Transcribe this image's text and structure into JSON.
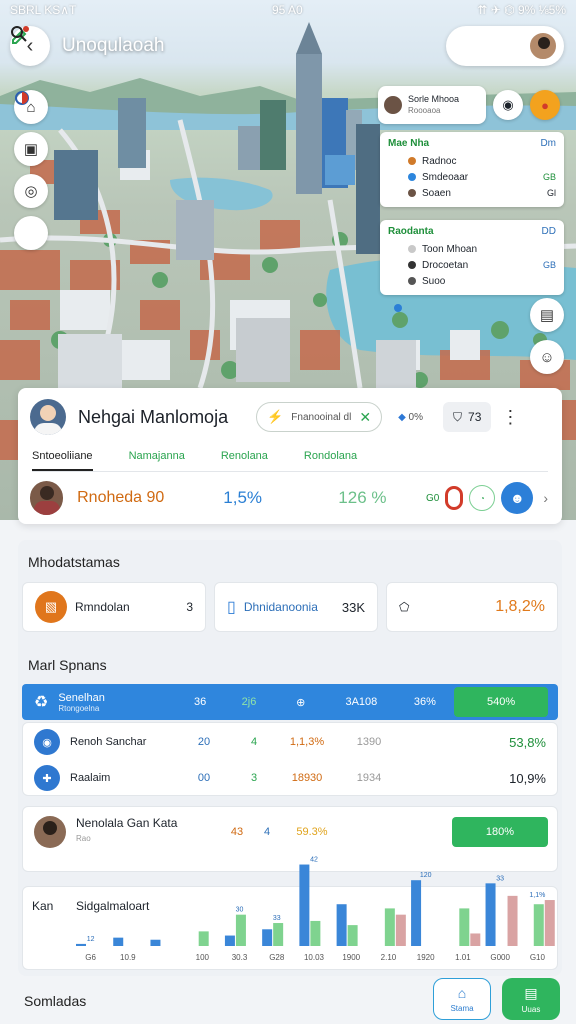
{
  "status": {
    "left": "SBRL  KS∧T",
    "time": "95 A0",
    "right": "⇈ ✈ ⌬ 9% ⅛5%"
  },
  "header": {
    "title": "Unoqulaoah",
    "back_icon": "chevron-left-icon",
    "action_icons": [
      "edit-icon",
      "search-icon"
    ]
  },
  "map_tools": [
    "home-icon",
    "bag-icon",
    "layers-icon",
    "compass-icon"
  ],
  "user_chip": {
    "name": "Sorle Mhooa",
    "sub": "Roooaoa"
  },
  "legend_card_1": {
    "title": "Mae Nha",
    "tag": "Dm",
    "rows": [
      {
        "label": "Radnoc",
        "value": "",
        "color": "#d07a2a"
      },
      {
        "label": "Smdeoaar",
        "value": "GB",
        "color": "#2d86dd"
      },
      {
        "label": "Soaen",
        "value": "Gl",
        "color": "#6b5345"
      }
    ]
  },
  "legend_card_2": {
    "title": "Raodanta",
    "tag": "DD",
    "rows": [
      {
        "label": "Toon Mhoan",
        "value": "",
        "color": "#c9c9c9"
      },
      {
        "label": "Drocoetan",
        "value": "GB",
        "color": "#333333"
      },
      {
        "label": "Suoo",
        "value": "",
        "color": "#555555"
      }
    ]
  },
  "profile": {
    "name": "Nehgai Manlomoja",
    "pill_text": "Fnanooinal dl",
    "stat": "0%",
    "flag_text": "73",
    "tabs": [
      "Sntoeoliiane",
      "Namajanna",
      "Renolana",
      "Rondolana"
    ],
    "metric1": "Rnoheda 90",
    "metric2": "1,5%",
    "metric3": "126 %",
    "badge_text": "G0"
  },
  "section1": {
    "title": "Mhodatstamas"
  },
  "cards": [
    {
      "label": "Rmndolan",
      "value": "3"
    },
    {
      "label": "Dhnidanoonia",
      "value": "33K"
    },
    {
      "label": "",
      "value": "1,8,2%"
    }
  ],
  "section2": {
    "title": "Marl Spnans"
  },
  "table": {
    "header": {
      "name": "Senelhan",
      "sub": "Rtongoelna",
      "a": "36",
      "b": "2j6",
      "c": "⊕",
      "d": "3A108",
      "e": "36%",
      "f": "540%"
    },
    "rows": [
      {
        "name": "Renoh Sanchar",
        "a": "20",
        "b": "4",
        "c": "1,1,3%",
        "d": "1390",
        "f": "53,8%"
      },
      {
        "name": "Raalaim",
        "a": "00",
        "b": "3",
        "c": "18930",
        "d": "1934",
        "f": "10,9%"
      }
    ]
  },
  "person_row": {
    "name": "Nenolala Gan Kata",
    "sub": "Rao",
    "a": "43",
    "b": "4",
    "c": "59.3%",
    "btn": "180%"
  },
  "chart_label": {
    "left": "Kan",
    "title": "Sidgalmaloart"
  },
  "chart_data": {
    "type": "bar",
    "title": "Sidgalmaloart",
    "categories": [
      "G6",
      "10.9",
      "",
      "100",
      "30.3",
      "G28",
      "10.03",
      "1900",
      "2.10",
      "1920",
      "1.01",
      "G000",
      "G10"
    ],
    "series": [
      {
        "color": "#3a86d8",
        "values": [
          2,
          8,
          6,
          0,
          10,
          16,
          78,
          40,
          0,
          63,
          0,
          60,
          0
        ]
      },
      {
        "color": "#7fd38f",
        "values": [
          0,
          0,
          0,
          14,
          30,
          22,
          24,
          20,
          36,
          0,
          36,
          0,
          40
        ]
      },
      {
        "color": "#d9a3a3",
        "values": [
          0,
          0,
          0,
          0,
          0,
          0,
          0,
          0,
          30,
          0,
          12,
          48,
          44
        ]
      }
    ],
    "data_labels": [
      "12",
      "",
      "",
      "",
      "30",
      "33",
      "42",
      "",
      "",
      "120",
      "",
      "33",
      "1,1%"
    ],
    "ylim": [
      0,
      90
    ]
  },
  "bottom": {
    "label": "Somladas",
    "nav": [
      {
        "label": "Stama",
        "icon": "home-icon"
      },
      {
        "label": "Uuas",
        "icon": "box-icon"
      }
    ]
  },
  "colors": {
    "accent_blue": "#2f86dd",
    "accent_green": "#2fb55e",
    "orange": "#e0761c"
  }
}
